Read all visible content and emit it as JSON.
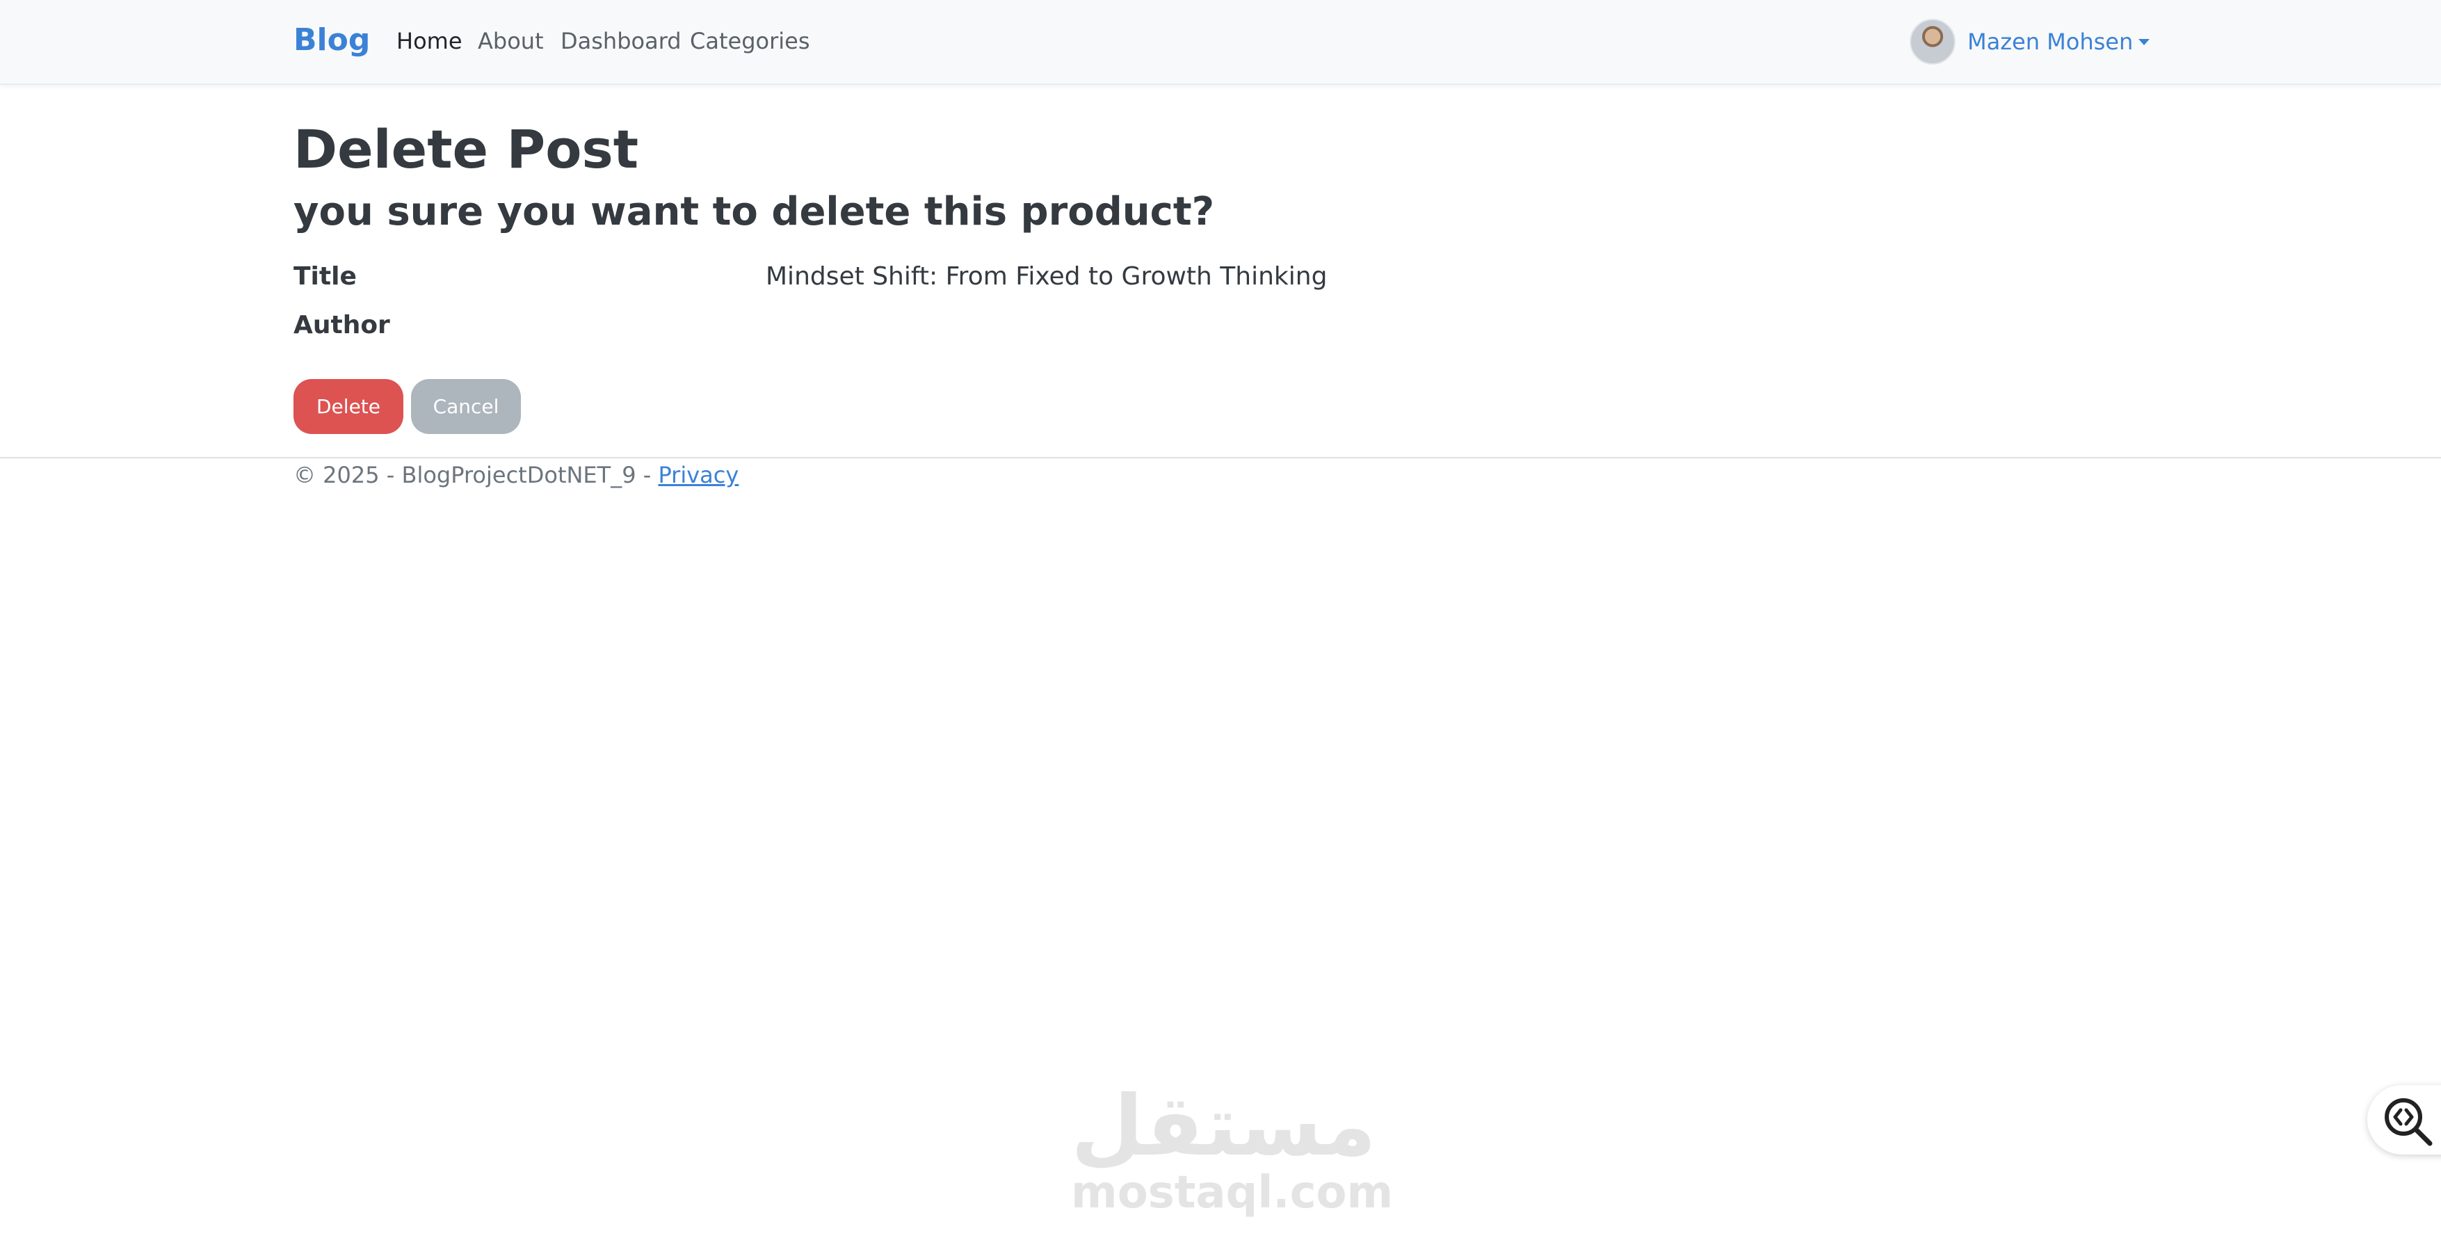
{
  "navbar": {
    "brand": "Blog",
    "links": [
      {
        "label": "Home",
        "active": true
      },
      {
        "label": "About"
      },
      {
        "label": "Dashboard"
      },
      {
        "label": "Categories"
      }
    ],
    "user": {
      "name": "Mazen Mohsen",
      "avatar_icon": "user-avatar-photo",
      "dropdown_icon": "caret-down-icon"
    }
  },
  "page": {
    "title": "Delete Post",
    "subtitle": "you sure you want to delete this product?"
  },
  "details": {
    "title_label": "Title",
    "title_value": "Mindset Shift: From Fixed to Growth Thinking",
    "author_label": "Author",
    "author_value": ""
  },
  "actions": {
    "delete_label": "Delete",
    "cancel_label": "Cancel"
  },
  "footer": {
    "copyright": "© 2025 - BlogProjectDotNET_9 - ",
    "privacy_link": "Privacy"
  },
  "watermark": {
    "arabic": "مستقل",
    "latin": "mostaql.com"
  },
  "side_widget": {
    "icon": "code-search-icon"
  },
  "colors": {
    "brand": "#3b82d6",
    "danger": "#dc5352",
    "secondary": "#adb5bd",
    "navbar_bg": "#f8f9fa"
  }
}
